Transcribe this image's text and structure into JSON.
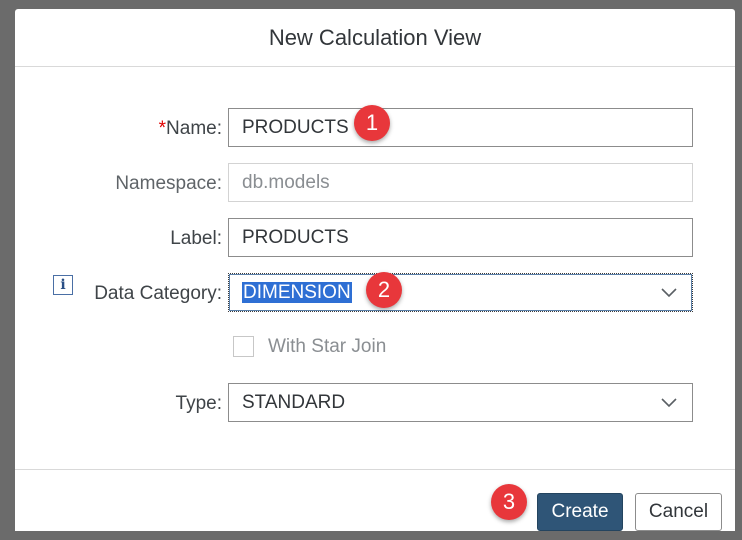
{
  "dialog": {
    "title": "New Calculation View",
    "create_label": "Create",
    "cancel_label": "Cancel"
  },
  "form": {
    "name": {
      "required_mark": "*",
      "label": "Name:",
      "value": "PRODUCTS"
    },
    "namespace": {
      "label": "Namespace:",
      "value": "db.models"
    },
    "label_field": {
      "label": "Label:",
      "value": "PRODUCTS"
    },
    "data_category": {
      "label": "Data Category:",
      "value": "DIMENSION",
      "info_icon": "i"
    },
    "star_join": {
      "label": "With Star Join",
      "checked": false
    },
    "type": {
      "label": "Type:",
      "value": "STANDARD"
    }
  },
  "annotations": {
    "step1": "1",
    "step2": "2",
    "step3": "3"
  },
  "colors": {
    "overlay": "#6b6b6b",
    "primary_button": "#2f5577",
    "required": "#e00000",
    "badge": "#e8373b",
    "selection": "#2e6fd4"
  }
}
